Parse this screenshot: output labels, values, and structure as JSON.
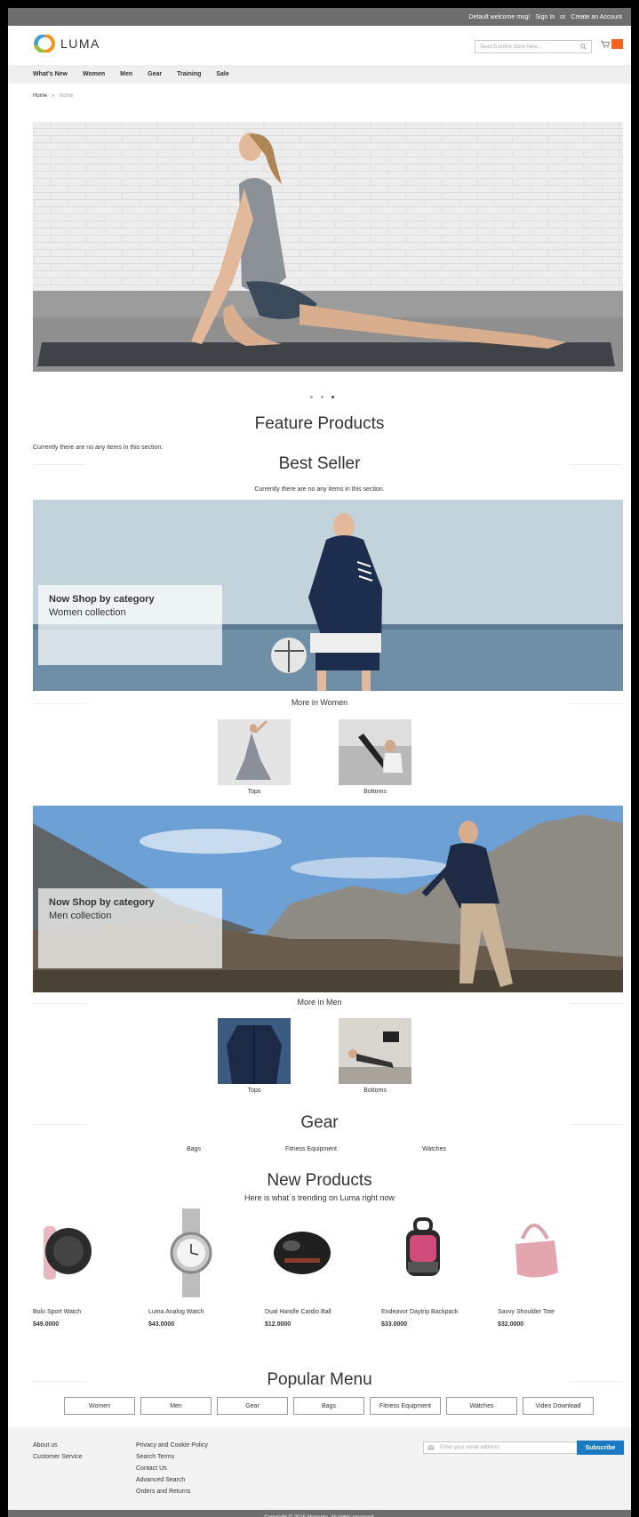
{
  "topbar": {
    "welcome": "Default welcome msg!",
    "sign_in": "Sign In",
    "or": "or",
    "create_account": "Create an Account"
  },
  "header": {
    "logo_text": "LUMA",
    "search_placeholder": "Search entire store here...",
    "cart_icon": "cart-icon",
    "accent": "#f26322"
  },
  "nav": {
    "items": [
      "What's New",
      "Women",
      "Men",
      "Gear",
      "Training",
      "Sale"
    ]
  },
  "breadcrumb": {
    "home": "Home",
    "separator": "›",
    "current": "home"
  },
  "sections": {
    "feature_title": "Feature Products",
    "feature_empty": "Currently there are no any items in this section.",
    "best_title": "Best Seller",
    "best_empty": "Currently there are no any items in this section."
  },
  "women_banner": {
    "title": "Now Shop by category",
    "subtitle": "Women collection",
    "more": "More in Women",
    "thumbs": [
      "Tops",
      "Bottoms"
    ]
  },
  "men_banner": {
    "title": "Now Shop by category",
    "subtitle": "Men collection",
    "more": "More in Men",
    "thumbs": [
      "Tops",
      "Bottoms"
    ]
  },
  "gear": {
    "title": "Gear",
    "links": [
      "Bags",
      "Fitness Equipment",
      "Watches"
    ]
  },
  "new_products": {
    "title": "New Products",
    "subtitle": "Here is what`s trending on Luma right now",
    "items": [
      {
        "name": "Bolo Sport Watch",
        "price": "$49.0000"
      },
      {
        "name": "Luma Analog Watch",
        "price": "$43.0000"
      },
      {
        "name": "Dual Handle Cardio Ball",
        "price": "$12.0000"
      },
      {
        "name": "Endeavor Daytrip Backpack",
        "price": "$33.0000"
      },
      {
        "name": "Savvy Shoulder Tote",
        "price": "$32.0000"
      }
    ]
  },
  "popular": {
    "title": "Popular Menu",
    "items": [
      "Women",
      "Men",
      "Gear",
      "Bags",
      "Fitness Equipment",
      "Watches",
      "Video Download"
    ]
  },
  "footer": {
    "col1": [
      "About us",
      "Customer Service"
    ],
    "col2": [
      "Privacy and Cookie Policy",
      "Search Terms",
      "Contact Us",
      "Advanced Search",
      "Orders and Returns"
    ],
    "email_placeholder": "Enter your email address",
    "subscribe": "Subscribe",
    "copyright": "Copyright © 2015 Magento. All rights reserved."
  },
  "colors": {
    "topbar": "#6e6e6e",
    "nav_bg": "#efefef",
    "subscribe": "#1979c3",
    "cart": "#f26322"
  }
}
